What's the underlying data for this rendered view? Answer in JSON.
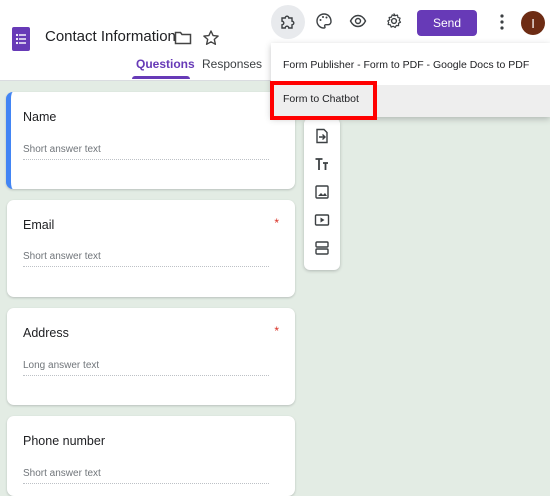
{
  "header": {
    "title": "Contact Information",
    "tabs": [
      {
        "label": "Questions",
        "active": true
      },
      {
        "label": "Responses",
        "active": false
      }
    ],
    "send_label": "Send",
    "avatar_initial": "I",
    "accent_color": "#673ab7"
  },
  "addon_menu": {
    "items": [
      {
        "label": "Form Publisher - Form to PDF - Google Docs to PDF"
      },
      {
        "label": "Form to Chatbot",
        "highlighted": true
      }
    ]
  },
  "questions": [
    {
      "title": "Name",
      "required": false,
      "placeholder": "Short answer text",
      "active": true
    },
    {
      "title": "Email",
      "required": true,
      "placeholder": "Short answer text"
    },
    {
      "title": "Address",
      "required": true,
      "placeholder": "Long answer text"
    },
    {
      "title": "Phone number",
      "required": false,
      "placeholder": "Short answer text"
    }
  ],
  "required_mark": "*",
  "toolbar_icons": [
    "import-questions-icon",
    "add-title-icon",
    "add-image-icon",
    "add-video-icon",
    "add-section-icon"
  ]
}
